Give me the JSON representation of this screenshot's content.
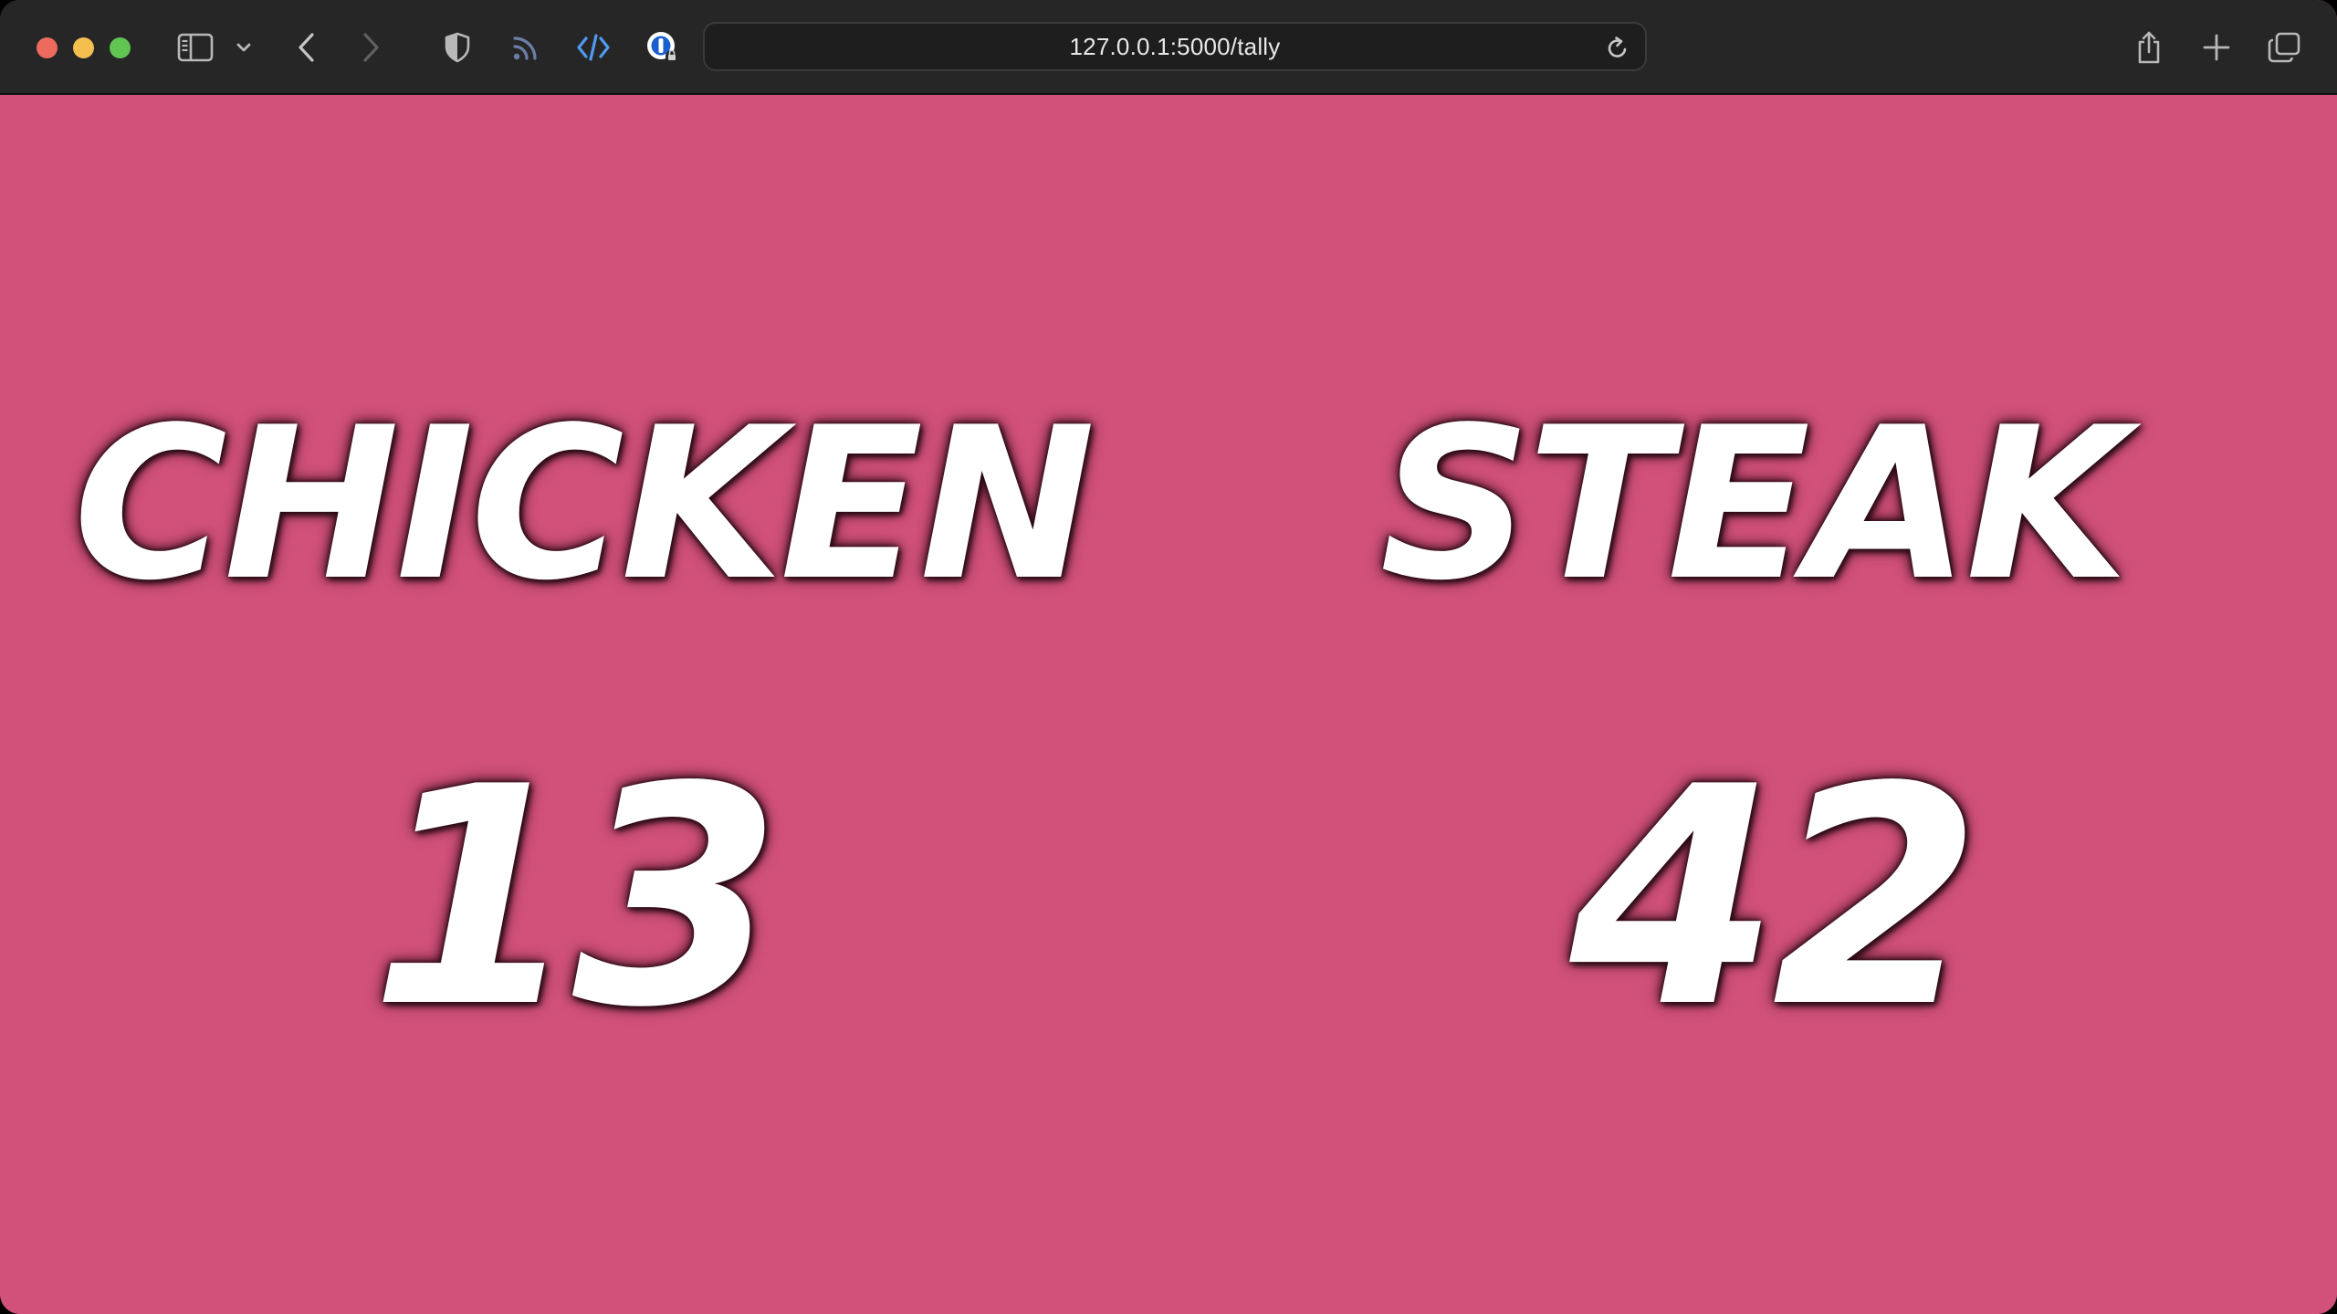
{
  "browser": {
    "url": "127.0.0.1:5000/tally",
    "colors": {
      "toolbar": "#262626",
      "close": "#ed6a5e",
      "minimize": "#f4bf4f",
      "maximize": "#61c554"
    },
    "icons": [
      "sidebar-icon",
      "chevron-down-icon",
      "back-icon",
      "forward-icon",
      "shield-icon",
      "rss-icon",
      "code-icon",
      "password-manager-icon",
      "reload-icon",
      "share-icon",
      "new-tab-icon",
      "tabs-overview-icon"
    ]
  },
  "page": {
    "background": "#d2517b",
    "tallies": [
      {
        "label": "Chicken",
        "count": "13"
      },
      {
        "label": "Steak",
        "count": "42"
      }
    ]
  }
}
